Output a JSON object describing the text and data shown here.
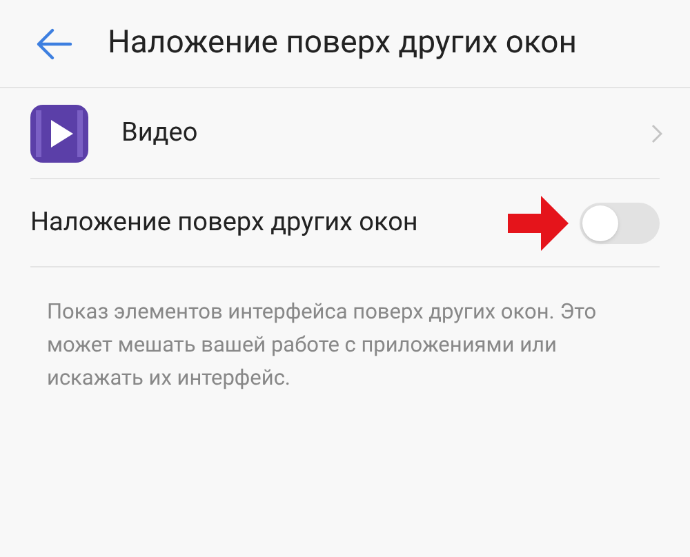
{
  "header": {
    "title": "Наложение поверх других окон"
  },
  "app": {
    "name": "Видео"
  },
  "setting": {
    "label": "Наложение поверх других окон",
    "on": false
  },
  "description": "Показ элементов интерфейса поверх других окон. Это может мешать вашей работе с приложениями или искажать их интерфейс."
}
